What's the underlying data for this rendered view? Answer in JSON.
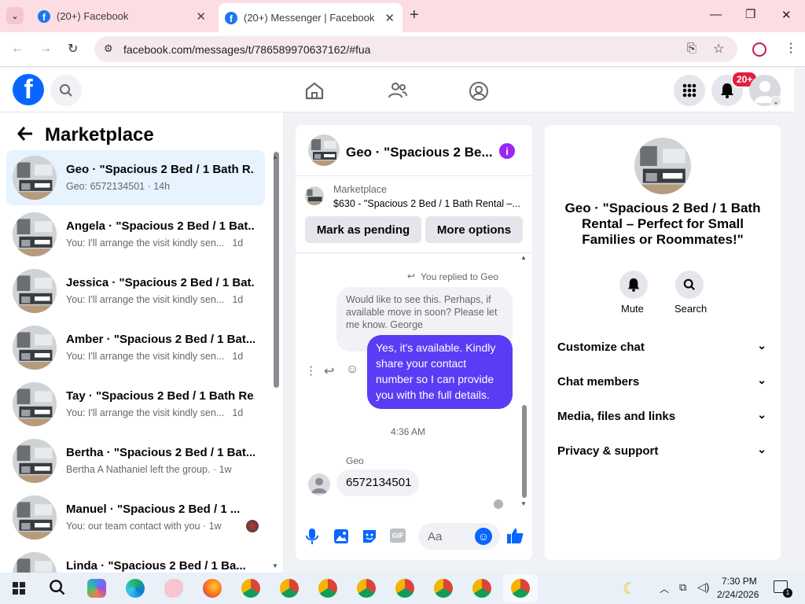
{
  "browser": {
    "tabs": [
      {
        "label": "(20+) Facebook"
      },
      {
        "label": "(20+) Messenger | Facebook"
      }
    ],
    "url": "facebook.com/messages/t/786589970637162/#fua"
  },
  "fb": {
    "notif_badge": "20+"
  },
  "left": {
    "title": "Marketplace",
    "conversations": [
      {
        "name": "Geo · \"Spacious 2 Bed / 1 Bath R...",
        "preview": "Geo: 6572134501 · 14h"
      },
      {
        "name": "Angela · \"Spacious 2 Bed / 1 Bat...",
        "preview": "You: I'll arrange the visit kindly sen...",
        "time": "1d"
      },
      {
        "name": "Jessica · \"Spacious 2 Bed / 1 Bat...",
        "preview": "You: I'll arrange the visit kindly sen...",
        "time": "1d"
      },
      {
        "name": "Amber · \"Spacious 2 Bed / 1 Bat...",
        "preview": "You: I'll arrange the visit kindly sen...",
        "time": "1d"
      },
      {
        "name": "Tay · \"Spacious 2 Bed / 1 Bath Re...",
        "preview": "You: I'll arrange the visit kindly sen...",
        "time": "1d"
      },
      {
        "name": "Bertha · \"Spacious 2 Bed / 1 Bat...",
        "preview": "Bertha A Nathaniel left the group. · 1w"
      },
      {
        "name": "Manuel · \"Spacious 2 Bed / 1 ...",
        "preview": "You: our team contact with you · 1w"
      },
      {
        "name": "Linda · \"Spacious 2 Bed / 1 Ba..."
      }
    ]
  },
  "chat": {
    "header_title": "Geo · \"Spacious 2 Be...",
    "listing_label": "Marketplace",
    "listing_title": "$630 - \"Spacious 2 Bed / 1 Bath Rental –...",
    "mark_pending": "Mark as pending",
    "more_options": "More options",
    "replied_label": "You replied to Geo",
    "quoted_message": "Would like to see this. Perhaps, if available move in soon? Please let me know. George",
    "my_message": "Yes, it's available. Kindly share your contact number so I can provide you with the full details.",
    "timestamp": "4:36 AM",
    "sender_name": "Geo",
    "their_message": "6572134501",
    "composer_placeholder": "Aa"
  },
  "info": {
    "title": "Geo · \"Spacious 2 Bed / 1 Bath Rental – Perfect for Small Families or Roommates!\"",
    "mute": "Mute",
    "search": "Search",
    "sections": [
      "Customize chat",
      "Chat members",
      "Media, files and links",
      "Privacy & support"
    ]
  },
  "taskbar": {
    "time": "7:30 PM",
    "date": "2/24/2026",
    "notif_count": "1"
  },
  "colors": {
    "fb_blue": "#0866ff",
    "bubble_purple": "#5b3cf5",
    "badge_red": "#e41e3f",
    "active_row": "#e7f3ff"
  }
}
